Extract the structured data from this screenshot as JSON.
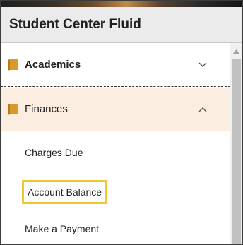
{
  "header": {
    "title": "Student Center Fluid"
  },
  "nav": {
    "items": [
      {
        "label": "Academics",
        "icon": "folder-icon",
        "expanded": false,
        "chevron": "chevron-down-icon"
      },
      {
        "label": "Finances",
        "icon": "folder-icon",
        "expanded": true,
        "chevron": "chevron-up-icon"
      }
    ],
    "finances_sub": [
      {
        "label": "Charges Due"
      },
      {
        "label": "Account Balance",
        "focused": true
      },
      {
        "label": "Make a Payment"
      }
    ]
  },
  "colors": {
    "folder": "#d99a2b",
    "expanded_bg": "#fbeee1",
    "focus_outline": "#f2c62f",
    "header_bg": "#ebebeb"
  }
}
